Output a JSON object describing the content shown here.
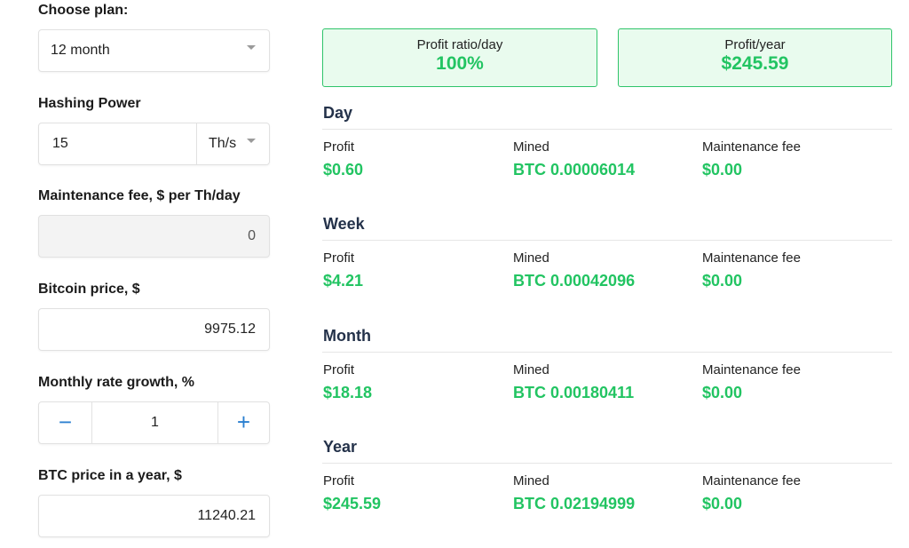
{
  "form": {
    "plan_label": "Choose plan:",
    "plan_value": "12 month",
    "hashing_label": "Hashing Power",
    "hashing_value": "15",
    "hashing_unit": "Th/s",
    "maint_label": "Maintenance fee, $ per Th/day",
    "maint_value": "0",
    "btc_price_label": "Bitcoin price, $",
    "btc_price_value": "9975.12",
    "growth_label": "Monthly rate growth, %",
    "growth_value": "1",
    "growth_minus": "−",
    "growth_plus": "+",
    "btc_year_label": "BTC price in a year, $",
    "btc_year_value": "11240.21"
  },
  "summary": {
    "ratio_title": "Profit ratio/day",
    "ratio_value": "100%",
    "year_title": "Profit/year",
    "year_value": "$245.59"
  },
  "columns": {
    "profit": "Profit",
    "mined": "Mined",
    "fee": "Maintenance fee"
  },
  "periods": [
    {
      "title": "Day",
      "profit": "$0.60",
      "mined": "BTC 0.00006014",
      "fee": "$0.00"
    },
    {
      "title": "Week",
      "profit": "$4.21",
      "mined": "BTC 0.00042096",
      "fee": "$0.00"
    },
    {
      "title": "Month",
      "profit": "$18.18",
      "mined": "BTC 0.00180411",
      "fee": "$0.00"
    },
    {
      "title": "Year",
      "profit": "$245.59",
      "mined": "BTC 0.02194999",
      "fee": "$0.00"
    }
  ],
  "colors": {
    "accent_green": "#22c462",
    "card_bg": "#e9fbee",
    "stepper_blue": "#2a7fd0"
  }
}
